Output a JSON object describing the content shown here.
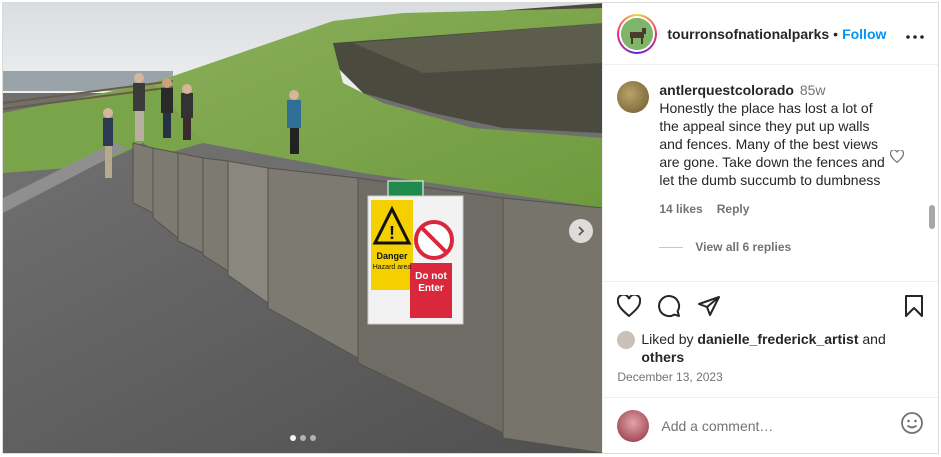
{
  "post": {
    "author": "tourronsofnationalparks",
    "follow_label": "Follow",
    "separator": "•",
    "more_label": "•••"
  },
  "photo": {
    "sign_danger": "Danger",
    "sign_danger_sub": "Hazard area",
    "sign_enter": "Do not Enter",
    "carousel_dots": 3,
    "active_dot": 0
  },
  "comment": {
    "user": "antlerquestcolorado",
    "time": "85w",
    "text": "Honestly the place has lost a lot of the appeal since they put up walls and fences. Many of the best views are gone. Take down the fences and let the dumb succumb to dumbness",
    "likes": "14 likes",
    "reply_label": "Reply",
    "view_replies": "View all 6 replies"
  },
  "liked_by": {
    "prefix": "Liked by",
    "user": "danielle_frederick_artist",
    "and": "and",
    "others": "others"
  },
  "date": "December 13, 2023",
  "add_comment": {
    "placeholder": "Add a comment…"
  },
  "icons": [
    "heart-icon",
    "comment-icon",
    "share-icon",
    "bookmark-icon",
    "emoji-icon",
    "chevron-right-icon",
    "more-icon"
  ],
  "colors": {
    "accent": "#0095f6",
    "secondary_text": "#737373",
    "sign_yellow": "#f5d000",
    "sign_red": "#d9283b",
    "sign_green": "#1f8a4c"
  }
}
